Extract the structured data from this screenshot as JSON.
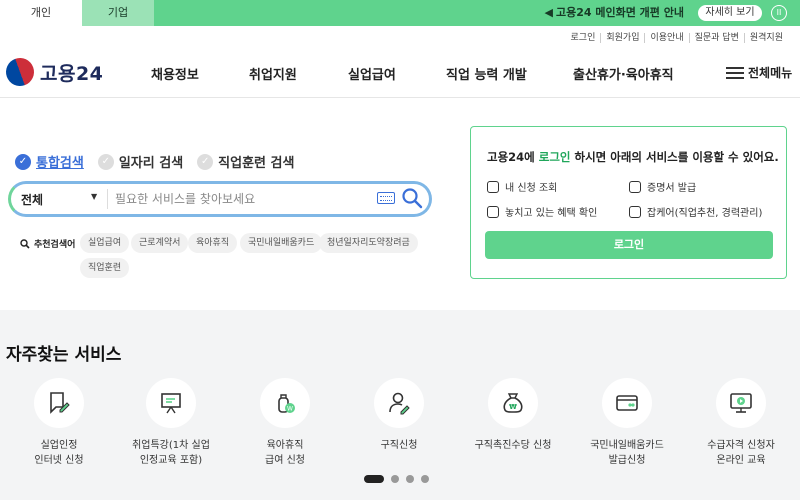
{
  "topbar": {
    "tabs": [
      "개인",
      "기업"
    ],
    "notice": "고용24 메인화면 개편 안내",
    "detail_label": "자세히 보기",
    "pause_label": "II"
  },
  "utility": [
    "로그인",
    "회원가입",
    "이용안내",
    "질문과 답변",
    "원격지원"
  ],
  "logo": {
    "text": "고용24"
  },
  "gnb": [
    "채용정보",
    "취업지원",
    "실업급여",
    "직업 능력 개발",
    "출산휴가·육아휴직"
  ],
  "allmenu_label": "전체메뉴",
  "search": {
    "tabs": [
      "통합검색",
      "일자리 검색",
      "직업훈련 검색"
    ],
    "category": "전체",
    "placeholder": "필요한 서비스를 찾아보세요",
    "recommend_label": "추천검색어",
    "chips": [
      "실업급여",
      "근로계약서",
      "육아휴직",
      "국민내일배움카드",
      "청년일자리도약장려금",
      "직업훈련"
    ]
  },
  "login_panel": {
    "msg_prefix": "고용24에 ",
    "msg_highlight": "로그인",
    "msg_suffix": " 하시면 아래의 서비스를 이용할 수 있어요.",
    "services": [
      "내 신청 조회",
      "증명서 발급",
      "놓치고 있는 혜택 확인",
      "잡케어(직업추천, 경력관리)"
    ],
    "button": "로그인"
  },
  "frequent": {
    "title": "자주찾는 서비스",
    "items": [
      {
        "label": "실업인정\n인터넷 신청",
        "icon": "document-pen-icon"
      },
      {
        "label": "취업특강(1차 실업\n인정교육 포함)",
        "icon": "presentation-board-icon"
      },
      {
        "label": "육아휴직\n급여 신청",
        "icon": "baby-bottle-icon"
      },
      {
        "label": "구직신청",
        "icon": "person-pen-icon"
      },
      {
        "label": "구직촉진수당 신청",
        "icon": "money-bag-icon"
      },
      {
        "label": "국민내일배움카드\n발급신청",
        "icon": "card-icon"
      },
      {
        "label": "수급자격 신청자\n온라인 교육",
        "icon": "monitor-play-icon"
      }
    ]
  },
  "colors": {
    "brand_green": "#5fd38d",
    "accent_blue": "#3a6fd8"
  }
}
